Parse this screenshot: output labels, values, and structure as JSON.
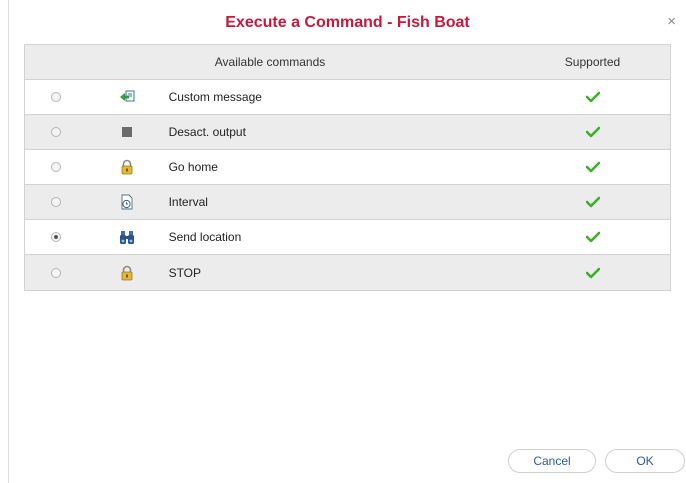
{
  "dialog": {
    "title": "Execute a Command - Fish Boat",
    "close_glyph": "×"
  },
  "table": {
    "col_commands": "Available commands",
    "col_supported": "Supported",
    "rows": [
      {
        "label": "Custom message",
        "icon": "message-arrow-icon",
        "selected": false,
        "supported": true
      },
      {
        "label": "Desact. output",
        "icon": "stop-square-icon",
        "selected": false,
        "supported": true
      },
      {
        "label": "Go home",
        "icon": "lock-icon",
        "selected": false,
        "supported": true
      },
      {
        "label": "Interval",
        "icon": "document-clock-icon",
        "selected": false,
        "supported": true
      },
      {
        "label": "Send location",
        "icon": "binoculars-icon",
        "selected": true,
        "supported": true
      },
      {
        "label": "STOP",
        "icon": "lock-icon",
        "selected": false,
        "supported": true
      }
    ]
  },
  "buttons": {
    "cancel": "Cancel",
    "ok": "OK"
  },
  "colors": {
    "title": "#c8193c",
    "check": "#3fae2a",
    "row_alt": "#ececec"
  }
}
